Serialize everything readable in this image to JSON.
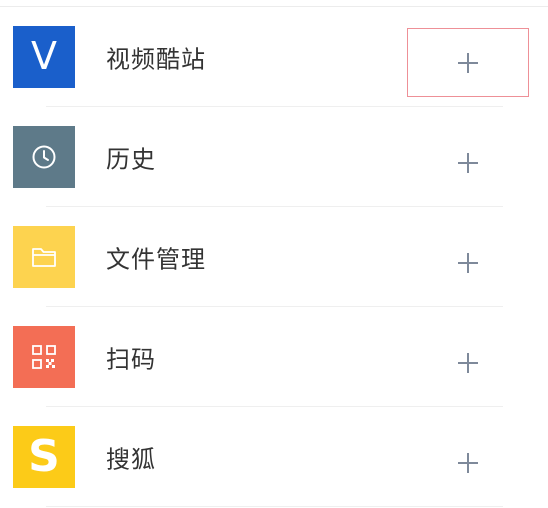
{
  "items": [
    {
      "label": "视频酷站",
      "icon": "v-logo-icon",
      "icon_text": "V",
      "color": "#1a5fcb"
    },
    {
      "label": "历史",
      "icon": "clock-icon",
      "color": "#5e7a89"
    },
    {
      "label": "文件管理",
      "icon": "folder-icon",
      "color": "#fdd34f"
    },
    {
      "label": "扫码",
      "icon": "qr-code-icon",
      "color": "#f36e55"
    },
    {
      "label": "搜狐",
      "icon": "sohu-logo-icon",
      "icon_text": "S",
      "color": "#fccb18"
    }
  ],
  "add_icon": "plus-icon",
  "highlight_color": "#ee9097"
}
